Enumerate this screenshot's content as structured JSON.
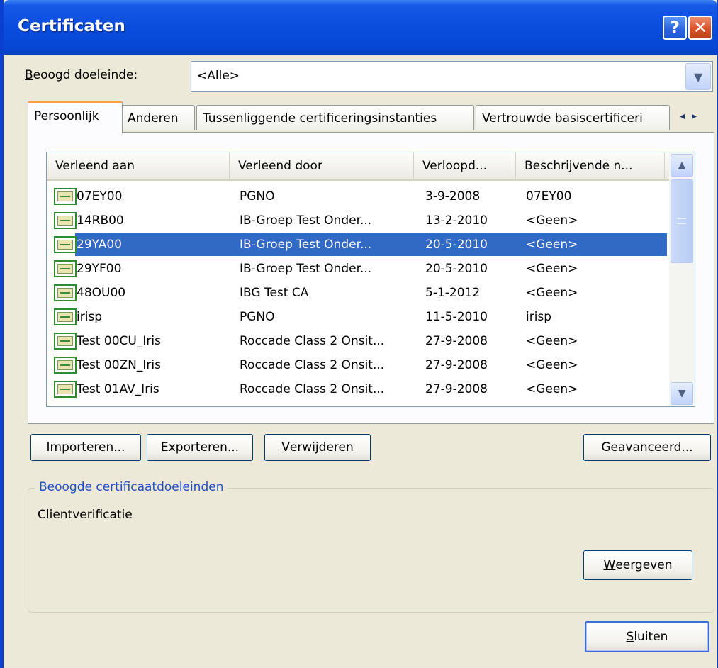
{
  "window": {
    "title": "Certificaten",
    "help_glyph": "?",
    "close_glyph": "✕"
  },
  "purpose": {
    "label": "Beoogd doeleinde:",
    "accel": "B",
    "label_rest": "eoogd doeleinde:",
    "value": "<Alle>"
  },
  "tabs": [
    {
      "label": "Persoonlijk",
      "active": true
    },
    {
      "label": "Anderen"
    },
    {
      "label": "Tussenliggende certificeringsinstanties"
    },
    {
      "label": "Vertrouwde basiscertificeri"
    }
  ],
  "tab_scroll": {
    "left": "◂",
    "right": "▸"
  },
  "list": {
    "columns": [
      "Verleend aan",
      "Verleend door",
      "Verloopd...",
      "Beschrijvende n..."
    ],
    "rows": [
      [
        "07EY00",
        "PGNO",
        "3-9-2008",
        "07EY00"
      ],
      [
        "14RB00",
        "IB-Groep Test Onder...",
        "13-2-2010",
        "<Geen>"
      ],
      [
        "29YA00",
        "IB-Groep Test Onder...",
        "20-5-2010",
        "<Geen>"
      ],
      [
        "29YF00",
        "IB-Groep Test Onder...",
        "20-5-2010",
        "<Geen>"
      ],
      [
        "48OU00",
        "IBG Test CA",
        "5-1-2012",
        "<Geen>"
      ],
      [
        "irisp",
        "PGNO",
        "11-5-2010",
        "irisp"
      ],
      [
        "Test 00CU_Iris",
        "Roccade Class 2 Onsit...",
        "27-9-2008",
        "<Geen>"
      ],
      [
        "Test 00ZN_Iris",
        "Roccade Class 2 Onsit...",
        "27-9-2008",
        "<Geen>"
      ],
      [
        "Test 01AV_Iris",
        "Roccade Class 2 Onsit...",
        "27-9-2008",
        "<Geen>"
      ]
    ],
    "selected_index": 2
  },
  "buttons": {
    "import": {
      "accel": "I",
      "rest": "mporteren..."
    },
    "export": {
      "accel": "E",
      "rest": "xporteren..."
    },
    "remove": {
      "accel": "V",
      "rest": "erwijderen"
    },
    "advanced": {
      "accel": "G",
      "rest": "eavanceerd..."
    },
    "view": {
      "accel": "W",
      "rest": "eergeven"
    },
    "close": {
      "accel": "S",
      "rest": "luiten"
    }
  },
  "purposes_group": {
    "title": "Beoogde certificaatdoeleinden",
    "value": "Clientverificatie"
  }
}
